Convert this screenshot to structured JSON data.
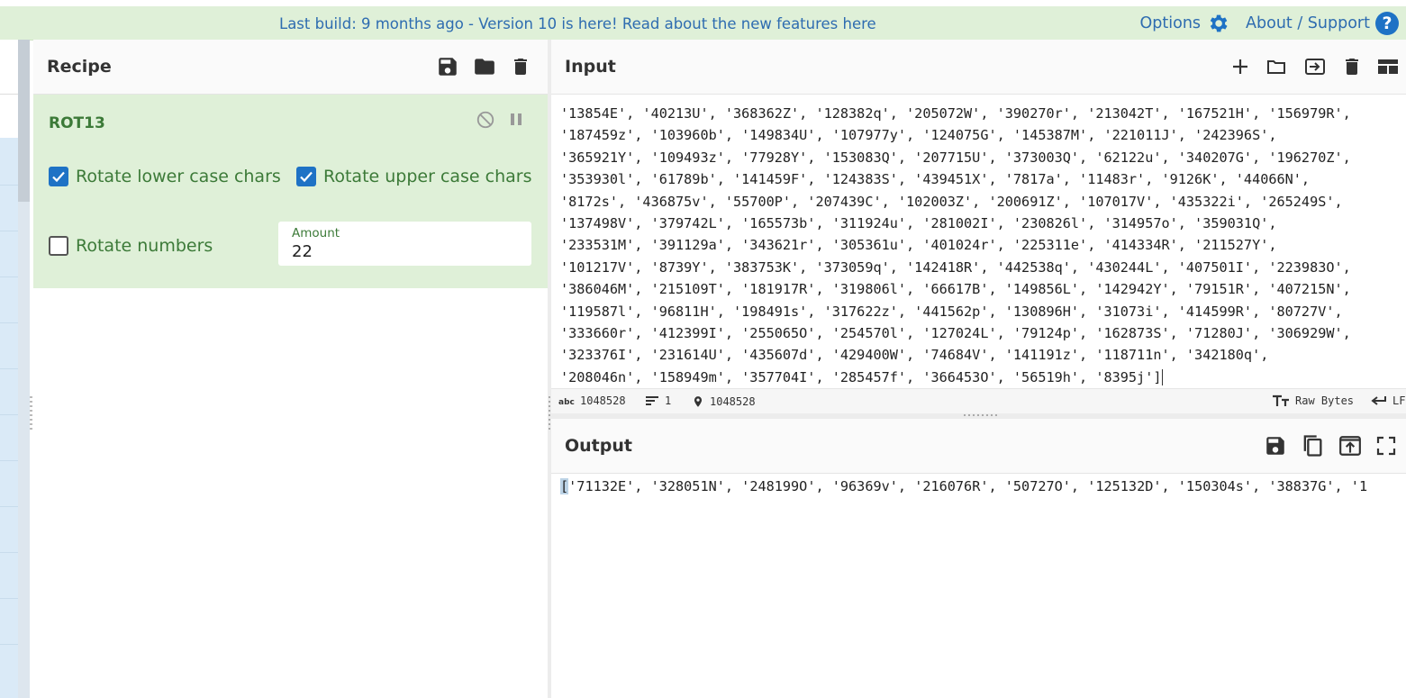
{
  "banner": {
    "message": "Last build: 9 months ago - Version 10 is here! Read about the new features here",
    "options_label": "Options",
    "about_label": "About / Support",
    "help_glyph": "?"
  },
  "recipe": {
    "title": "Recipe",
    "operation": {
      "name": "ROT13",
      "rotate_lower_label": "Rotate lower case chars",
      "rotate_lower_checked": true,
      "rotate_upper_label": "Rotate upper case chars",
      "rotate_upper_checked": true,
      "rotate_numbers_label": "Rotate numbers",
      "rotate_numbers_checked": false,
      "amount_label": "Amount",
      "amount_value": "22"
    }
  },
  "input": {
    "title": "Input",
    "lines": [
      "'13854E', '40213U', '368362Z', '128382q', '205072W', '390270r', '213042T', '167521H', '156979R',",
      "'187459z', '103960b', '149834U', '107977y', '124075G', '145387M', '221011J', '242396S',",
      "'365921Y', '109493z', '77928Y', '153083Q', '207715U', '373003Q', '62122u', '340207G', '196270Z',",
      "'353930l', '61789b', '141459F', '124383S', '439451X', '7817a', '11483r', '9126K', '44066N',",
      "'8172s', '436875v', '55700P', '207439C', '102003Z', '200691Z', '107017V', '435322i', '265249S',",
      "'137498V', '379742L', '165573b', '311924u', '281002I', '230826l', '314957o', '359031Q',",
      "'233531M', '391129a', '343621r', '305361u', '401024r', '225311e', '414334R', '211527Y',",
      "'101217V', '8739Y', '383753K', '373059q', '142418R', '442538q', '430244L', '407501I', '223983O',",
      "'386046M', '215109T', '181917R', '319806l', '66617B', '149856L', '142942Y', '79151R', '407215N',",
      "'119587l', '96811H', '198491s', '317622z', '441562p', '130896H', '31073i', '414599R', '80727V',",
      "'333660r', '412399I', '255065O', '254570l', '127024L', '79124p', '162873S', '71280J', '306929W',",
      "'323376I', '231614U', '435607d', '429400W', '74684V', '141191z', '118711n', '342180q',",
      "'208046n', '158949m', '357704I', '285457f', '366453O', '56519h', '8395j']"
    ],
    "status": {
      "length": "1048528",
      "lines": "1",
      "position": "1048528",
      "encoding": "Raw Bytes",
      "eol": "LF"
    }
  },
  "output": {
    "title": "Output",
    "first_char": "[",
    "text": "'71132E', '328051N', '248199O', '96369v', '216076R', '50727O', '125132D', '150304s', '38837G', '1"
  },
  "colors": {
    "banner_bg": "#dff0d8",
    "link": "#2e6cb0",
    "operation_bg": "#dff0d8",
    "operation_text": "#3c7a38",
    "checkbox_on": "#1e72c5"
  },
  "icons": [
    "gear-icon",
    "help-icon",
    "save-icon",
    "folder-icon",
    "trash-icon",
    "disable-icon",
    "pause-icon",
    "plus-icon",
    "import-icon",
    "layout-icon",
    "copy-icon",
    "replace-input-icon",
    "maximise-icon",
    "text-length-icon",
    "lines-icon",
    "location-icon",
    "font-icon",
    "eol-icon"
  ]
}
